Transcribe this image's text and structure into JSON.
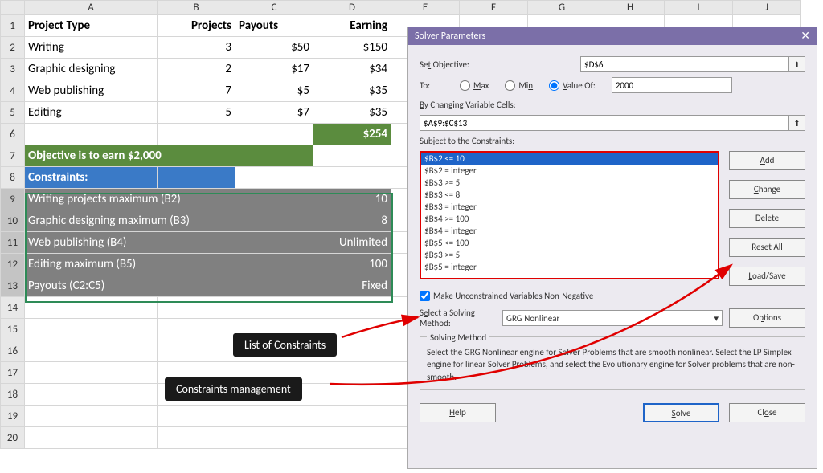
{
  "columns": [
    "A",
    "B",
    "C",
    "D",
    "E",
    "F",
    "G",
    "H",
    "I",
    "J"
  ],
  "header": {
    "c1": "Project Type",
    "c2": "Projects",
    "c3": "Payouts",
    "c4": "Earning"
  },
  "rows": [
    {
      "type": "Writing",
      "projects": "3",
      "payout": "$50",
      "earning": "$150"
    },
    {
      "type": "Graphic designing",
      "projects": "2",
      "payout": "$17",
      "earning": "$34"
    },
    {
      "type": "Web publishing",
      "projects": "7",
      "payout": "$5",
      "earning": "$35"
    },
    {
      "type": "Editing",
      "projects": "5",
      "payout": "$7",
      "earning": "$35"
    }
  ],
  "total": "$254",
  "objective_text": "Objective is to earn $2,000",
  "constraints_header": "Constraints:",
  "constraint_rows": [
    {
      "label": "Writing projects maximum (B2)",
      "value": "10"
    },
    {
      "label": "Graphic designing maximum (B3)",
      "value": "8"
    },
    {
      "label": "Web publishing (B4)",
      "value": "Unlimited"
    },
    {
      "label": "Editing maximum (B5)",
      "value": "100"
    },
    {
      "label": "Payouts (C2:C5)",
      "value": "Fixed"
    }
  ],
  "annotations": {
    "list_constraints": "List of Constraints",
    "constraints_mgmt": "Constraints management"
  },
  "dialog": {
    "title": "Solver Parameters",
    "set_objective": "Set Objective:",
    "objective_val": "$D$6",
    "to": "To:",
    "max": "Max",
    "min": "Min",
    "value_of": "Value Of:",
    "value_of_val": "2000",
    "changing_cells": "By Changing Variable Cells:",
    "changing_val": "$A$9:$C$13",
    "subject": "Subject to the Constraints:",
    "constraints": [
      "$B$2 <= 10",
      "$B$2 = integer",
      "$B$3 >= 5",
      "$B$3 <= 8",
      "$B$3 = integer",
      "$B$4 >= 100",
      "$B$4 = integer",
      "$B$5 <= 100",
      "$B$3 >= 5",
      "$B$5 = integer"
    ],
    "add": "Add",
    "change": "Change",
    "delete": "Delete",
    "reset_all": "Reset All",
    "load_save": "Load/Save",
    "nonneg": "Make Unconstrained Variables Non-Negative",
    "sel_solving": "Select a Solving Method:",
    "method": "GRG Nonlinear",
    "options": "Options",
    "solving_method_title": "Solving Method",
    "solving_method_text": "Select the GRG Nonlinear engine for Solver Problems that are smooth nonlinear. Select the LP Simplex engine for linear Solver Problems, and select the Evolutionary engine for Solver problems that are non-smooth.",
    "help": "Help",
    "solve": "Solve",
    "close": "Close"
  }
}
